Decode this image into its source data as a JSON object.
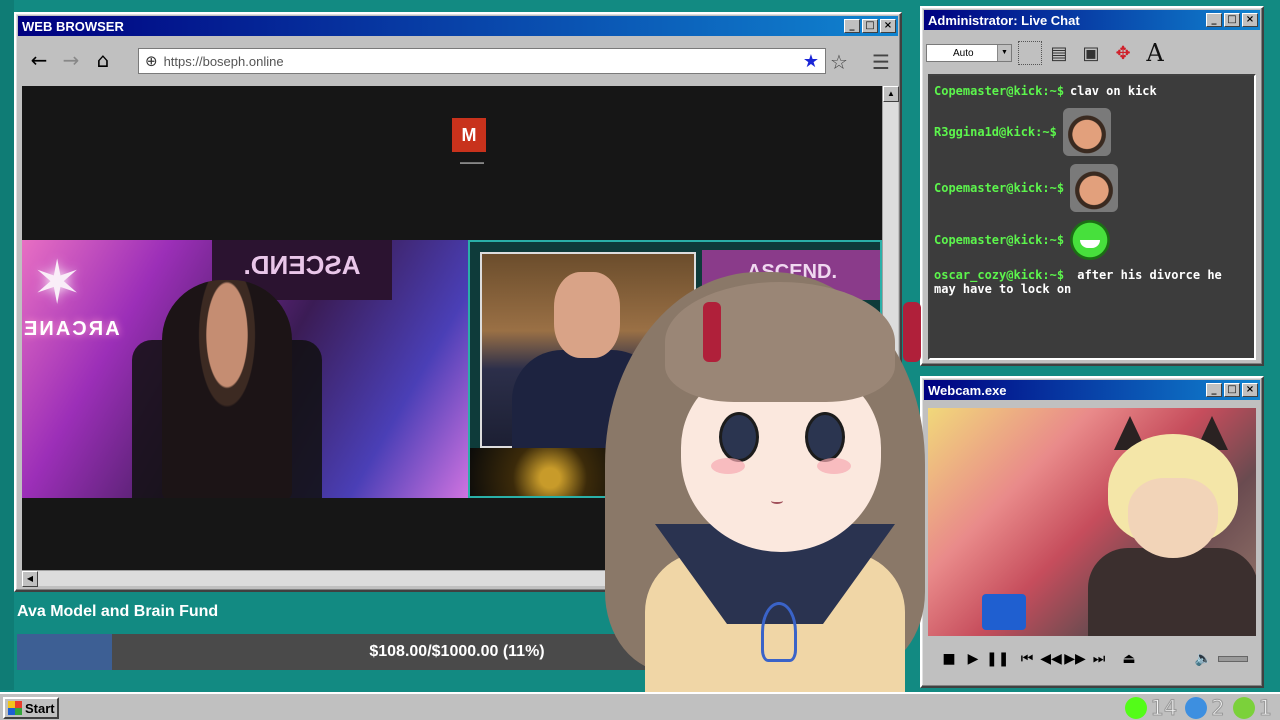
{
  "browser": {
    "title": "WEB BROWSER",
    "url": "https://boseph.online",
    "nav": {
      "back": "←",
      "forward": "→",
      "home": "⌂"
    },
    "stream": {
      "logo_letter": "M",
      "left_banner": "ASCEND.",
      "left_sign": "ARCANE",
      "right_banner": "ASCEND."
    }
  },
  "donation": {
    "title": "Ava Model and Brain Fund",
    "status_text": "$108.00/$1000.00 (11%)",
    "progress_fraction": 0.108,
    "fill_color": "#3d5f94"
  },
  "chat": {
    "title": "Administrator: Live Chat",
    "font_select": "Auto",
    "tools": [
      "selection-tool-icon",
      "document-icon",
      "paste-icon",
      "move-icon",
      "font-icon"
    ],
    "font_tool_label": "A",
    "messages": [
      {
        "user": "Copemaster@kick:~$",
        "text": "clav on kick",
        "emote": null
      },
      {
        "user": "R3ggina1d@kick:~$",
        "text": "",
        "emote": "face"
      },
      {
        "user": "Copemaster@kick:~$",
        "text": "",
        "emote": "face"
      },
      {
        "user": "Copemaster@kick:~$",
        "text": "",
        "emote": "green"
      },
      {
        "user": "oscar_cozy@kick:~$",
        "text": "after his divorce he may have to lock on",
        "emote": null
      }
    ]
  },
  "webcam": {
    "title": "Webcam.exe",
    "controls": [
      "stop",
      "play",
      "pause",
      "previous",
      "rewind",
      "fast-forward",
      "next",
      "eject",
      "volume"
    ]
  },
  "taskbar": {
    "start_label": "Start",
    "tray": [
      {
        "icon": "kick-icon",
        "count": "14",
        "color": "#53fc18"
      },
      {
        "icon": "moon-icon",
        "count": "2",
        "color": "#3d8fe0"
      },
      {
        "icon": "play-circle-icon",
        "count": "1",
        "color": "#7bd13a"
      }
    ]
  }
}
